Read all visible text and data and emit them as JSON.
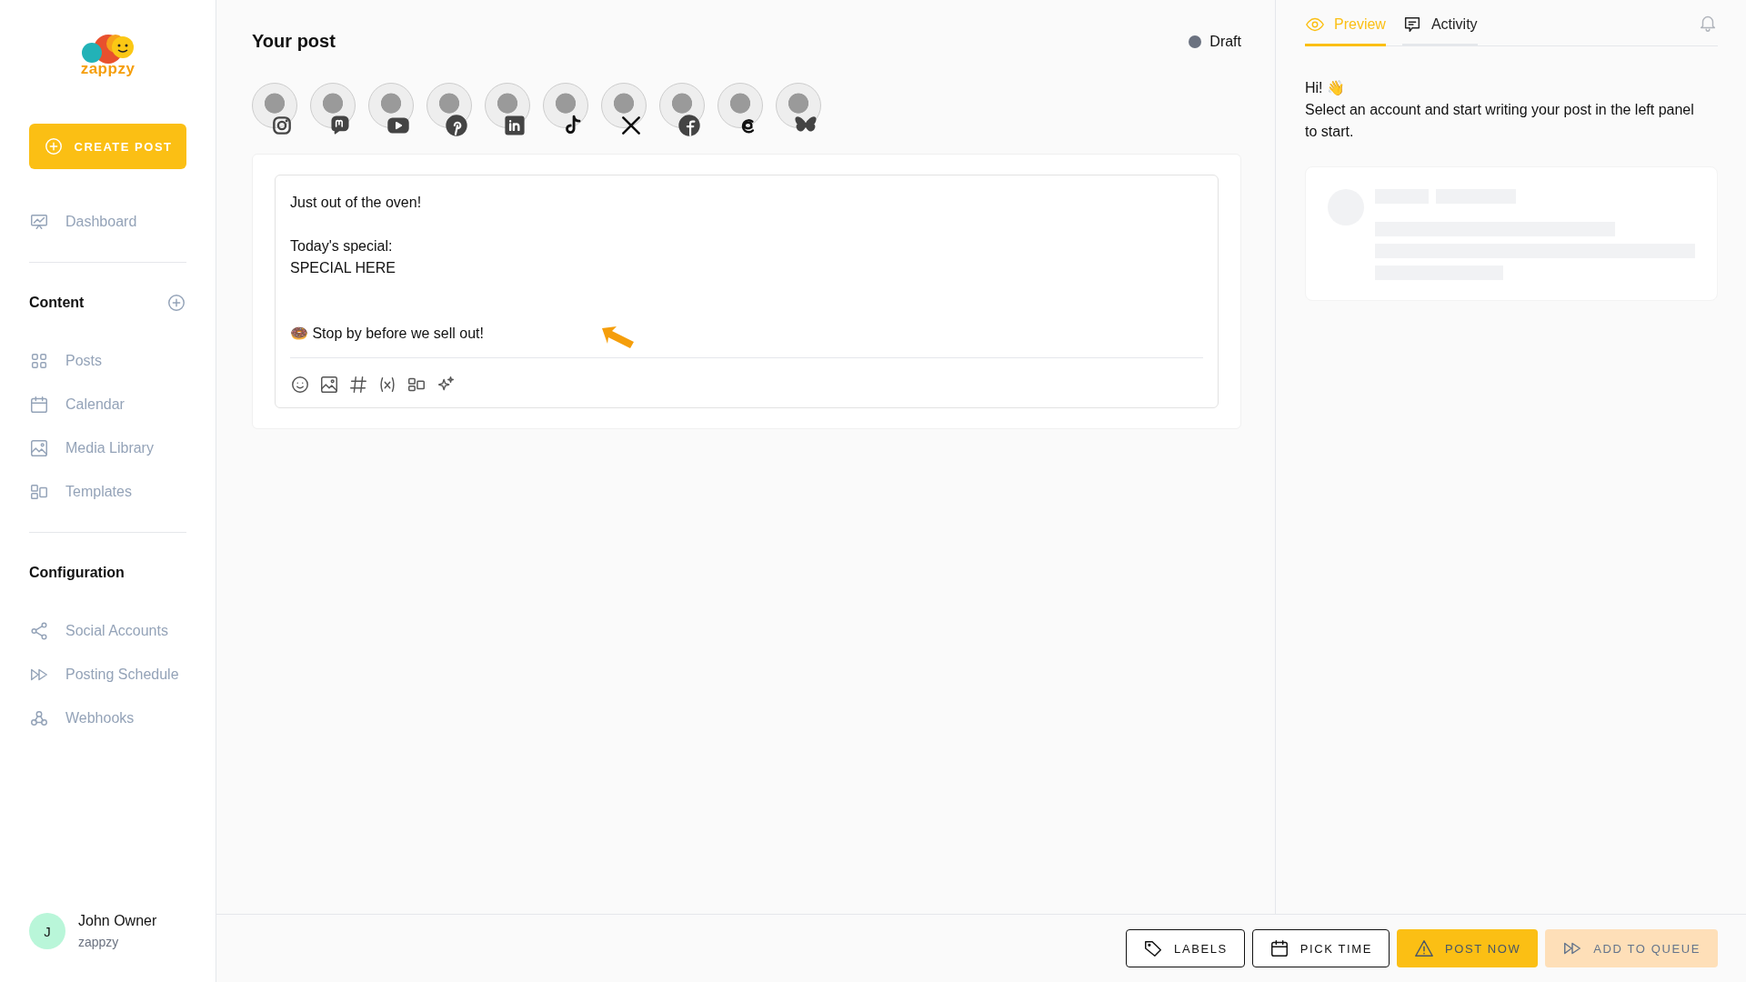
{
  "sidebar": {
    "logo_text": "zappzy",
    "create_button": "CREATE POST",
    "top_items": [
      {
        "label": "Dashboard"
      }
    ],
    "sections": [
      {
        "title": "Content",
        "has_add": true,
        "items": [
          {
            "label": "Posts"
          },
          {
            "label": "Calendar"
          },
          {
            "label": "Media Library"
          },
          {
            "label": "Templates"
          }
        ]
      },
      {
        "title": "Configuration",
        "has_add": false,
        "items": [
          {
            "label": "Social Accounts"
          },
          {
            "label": "Posting Schedule"
          },
          {
            "label": "Webhooks"
          }
        ]
      }
    ],
    "user": {
      "initial": "J",
      "name": "John Owner",
      "org": "zappzy"
    }
  },
  "post": {
    "title": "Your post",
    "status": "Draft",
    "accounts": [
      {
        "kind": "instagram"
      },
      {
        "kind": "mastodon"
      },
      {
        "kind": "youtube"
      },
      {
        "kind": "pinterest"
      },
      {
        "kind": "linkedin"
      },
      {
        "kind": "tiktok"
      },
      {
        "kind": "x"
      },
      {
        "kind": "facebook"
      },
      {
        "kind": "threads"
      },
      {
        "kind": "bluesky"
      }
    ],
    "text": "Just out of the oven!\n\nToday's special:\nSPECIAL HERE\n\n\n🍩 Stop by before we sell out!"
  },
  "preview": {
    "tabs": [
      {
        "label": "Preview",
        "selected": true
      },
      {
        "label": "Activity",
        "selected": false
      }
    ],
    "greeting": "Hi! 👋",
    "message": "Select an account and start writing your post in the left panel to start."
  },
  "actions": [
    {
      "label": "LABELS",
      "kind": "outline"
    },
    {
      "label": "PICK TIME",
      "kind": "outline"
    },
    {
      "label": "POST NOW",
      "kind": "primary"
    },
    {
      "label": "ADD TO QUEUE",
      "kind": "soft"
    }
  ]
}
